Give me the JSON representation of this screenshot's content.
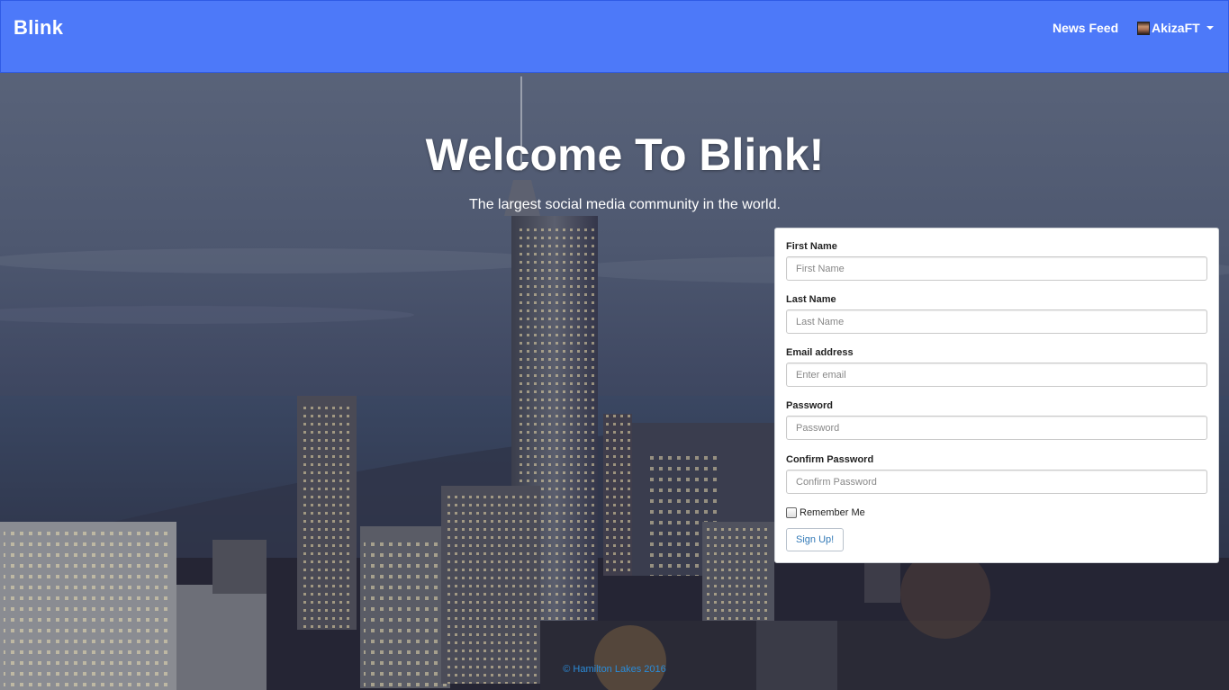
{
  "navbar": {
    "brand": "Blink",
    "news_feed": "News Feed",
    "user_name": "AkizaFT",
    "brand_color": "#4d79f9"
  },
  "hero": {
    "title": "Welcome To Blink!",
    "subtitle": "The largest social media community in the world."
  },
  "form": {
    "first_name": {
      "label": "First Name",
      "placeholder": "First Name"
    },
    "last_name": {
      "label": "Last Name",
      "placeholder": "Last Name"
    },
    "email": {
      "label": "Email address",
      "placeholder": "Enter email"
    },
    "password": {
      "label": "Password",
      "placeholder": "Password"
    },
    "confirm_password": {
      "label": "Confirm Password",
      "placeholder": "Confirm Password"
    },
    "remember_me": "Remember Me",
    "submit": "Sign Up!"
  },
  "footer": {
    "text": "© Hamilton Lakes 2016"
  }
}
